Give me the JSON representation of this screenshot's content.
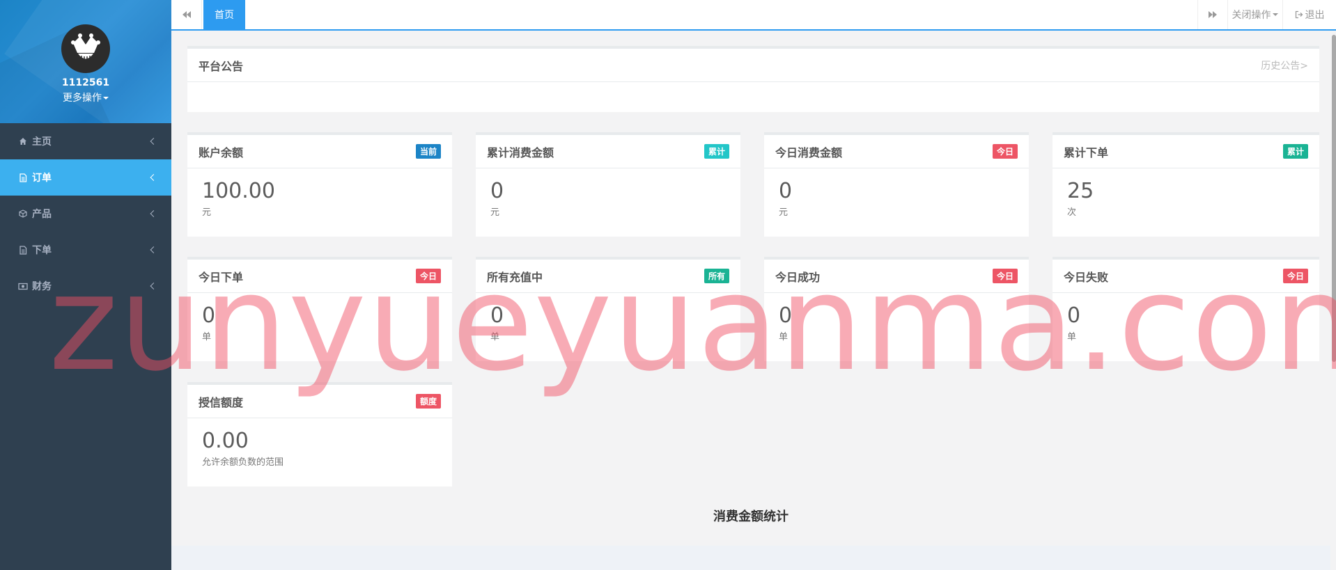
{
  "profile": {
    "username": "1112561",
    "more_label": "更多操作"
  },
  "nav": {
    "items": [
      {
        "label": "主页",
        "icon": "home-icon"
      },
      {
        "label": "订单",
        "icon": "file-icon",
        "active": true
      },
      {
        "label": "产品",
        "icon": "cube-icon"
      },
      {
        "label": "下单",
        "icon": "file-text-icon"
      },
      {
        "label": "财务",
        "icon": "money-icon"
      }
    ]
  },
  "topbar": {
    "home_tab": "首页",
    "close_ops": "关闭操作",
    "logout": "退出"
  },
  "notice": {
    "title": "平台公告",
    "history": "历史公告>"
  },
  "stats": [
    {
      "title": "账户余额",
      "badge": "当前",
      "badge_color": "#1c84c6",
      "value": "100.00",
      "unit": "元"
    },
    {
      "title": "累计消费金额",
      "badge": "累计",
      "badge_color": "#23c6c8",
      "value": "0",
      "unit": "元"
    },
    {
      "title": "今日消费金额",
      "badge": "今日",
      "badge_color": "#ed5565",
      "value": "0",
      "unit": "元"
    },
    {
      "title": "累计下单",
      "badge": "累计",
      "badge_color": "#1ab394",
      "value": "25",
      "unit": "次"
    },
    {
      "title": "今日下单",
      "badge": "今日",
      "badge_color": "#ed5565",
      "value": "0",
      "unit": "单"
    },
    {
      "title": "所有充值中",
      "badge": "所有",
      "badge_color": "#1ab394",
      "value": "0",
      "unit": "单"
    },
    {
      "title": "今日成功",
      "badge": "今日",
      "badge_color": "#ed5565",
      "value": "0",
      "unit": "单"
    },
    {
      "title": "今日失败",
      "badge": "今日",
      "badge_color": "#ed5565",
      "value": "0",
      "unit": "单"
    },
    {
      "title": "授信额度",
      "badge": "额度",
      "badge_color": "#ed5565",
      "value": "0.00",
      "unit": "允许余额负数的范围"
    }
  ],
  "chart_section_title": "消费金额统计",
  "watermark": "zunyueyuanma.com"
}
